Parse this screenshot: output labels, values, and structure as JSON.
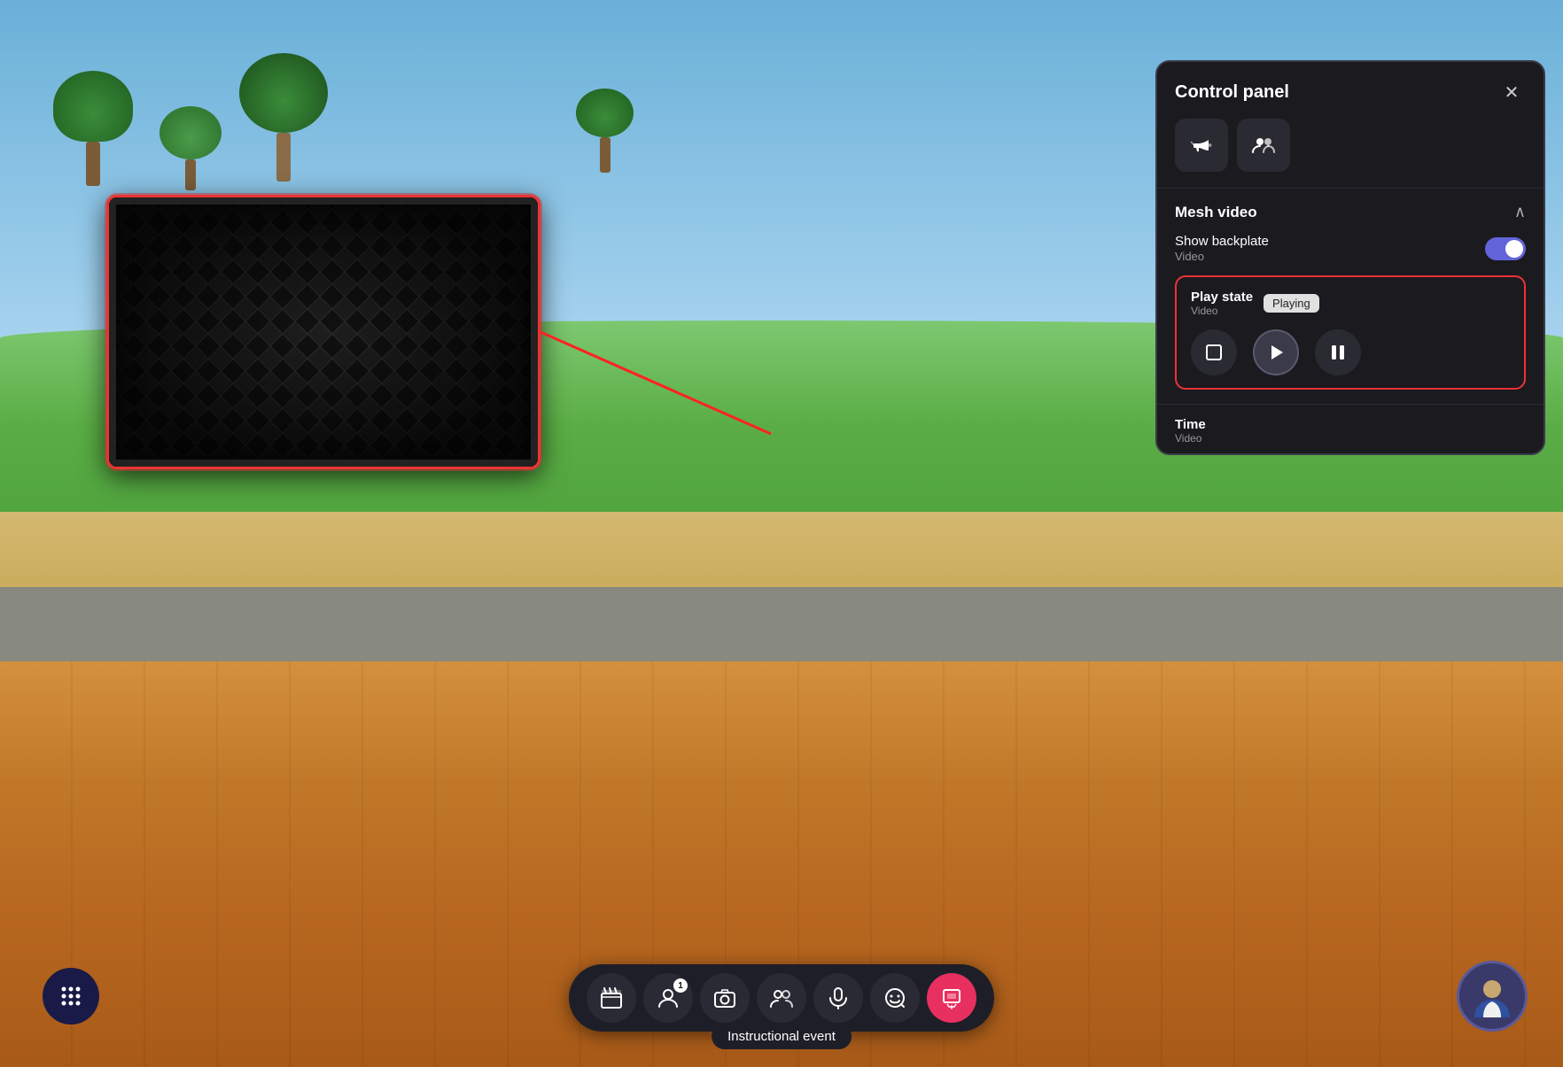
{
  "scene": {
    "description": "Virtual 3D environment with grass, trees, wooden floor"
  },
  "control_panel": {
    "title": "Control panel",
    "close_label": "✕",
    "icon_buttons": [
      {
        "name": "megaphone-icon",
        "symbol": "🔔",
        "label": "Megaphone"
      },
      {
        "name": "avatar-icon",
        "symbol": "👥",
        "label": "Avatar"
      }
    ],
    "mesh_video_section": {
      "title": "Mesh video",
      "chevron": "∧",
      "show_backplate": {
        "label": "Show backplate",
        "sublabel": "Video",
        "toggle_on": true
      },
      "play_state": {
        "title": "Play state",
        "sublabel": "Video",
        "status_badge": "Playing",
        "controls": [
          {
            "name": "stop-button",
            "symbol": "□"
          },
          {
            "name": "play-button",
            "symbol": "▶"
          },
          {
            "name": "pause-button",
            "symbol": "⏸"
          }
        ]
      },
      "time": {
        "title": "Time",
        "sublabel": "Video"
      }
    }
  },
  "toolbar": {
    "buttons": [
      {
        "name": "scene-button",
        "symbol": "🎬",
        "label": "Scene"
      },
      {
        "name": "people-button",
        "symbol": "👤",
        "label": "People",
        "badge": "1"
      },
      {
        "name": "camera-button",
        "symbol": "📷",
        "label": "Camera"
      },
      {
        "name": "avatars-button",
        "symbol": "👥",
        "label": "Avatars"
      },
      {
        "name": "mic-button",
        "symbol": "🎙",
        "label": "Mic"
      },
      {
        "name": "emoji-button",
        "symbol": "😊",
        "label": "Emoji"
      },
      {
        "name": "share-button",
        "symbol": "📱",
        "label": "Share",
        "active": true
      }
    ],
    "grid_button": {
      "symbol": "⋮⋮⋮",
      "label": "Grid"
    },
    "event_label": "Instructional event"
  },
  "video_screen": {
    "description": "Mesh video display showing diamond texture pattern"
  }
}
